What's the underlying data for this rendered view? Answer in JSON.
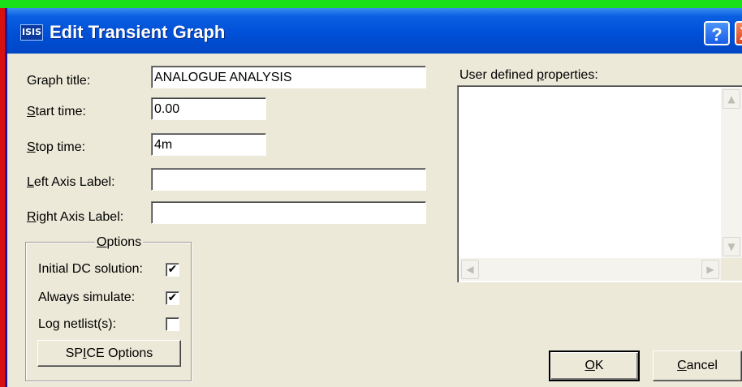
{
  "window": {
    "title": "Edit Transient Graph",
    "app_icon_text": "ISIS",
    "help_glyph": "?",
    "close_glyph": "X",
    "titlebar_color": "#0050d8"
  },
  "form": {
    "graph_title": {
      "label": "Graph title:",
      "value": "ANALOGUE ANALYSIS"
    },
    "start_time": {
      "label_ul": "S",
      "label_rest": "tart time:",
      "value": "0.00"
    },
    "stop_time": {
      "label_ul": "S",
      "label_rest": "top time:",
      "value": "4m"
    },
    "left_axis": {
      "label_ul": "L",
      "label_rest": "eft Axis Label:",
      "value": ""
    },
    "right_axis": {
      "label_ul": "R",
      "label_rest": "ight Axis Label:",
      "value": ""
    }
  },
  "options": {
    "legend_ul": "O",
    "legend_rest": "ptions",
    "initial_dc": {
      "label": "Initial DC solution:",
      "checked": true,
      "mark": "✔"
    },
    "always_simulate": {
      "label": "Always simulate:",
      "checked": true,
      "mark": "✔"
    },
    "log_netlist": {
      "label": "Log netlist(s):",
      "checked": false,
      "mark": ""
    },
    "spice_button": {
      "pre": "SP",
      "ul": "I",
      "post": "CE Options"
    }
  },
  "user_props": {
    "label_pre": "User defined ",
    "label_ul": "p",
    "label_post": "roperties:",
    "content": ""
  },
  "buttons": {
    "ok": {
      "ul": "O",
      "rest": "K"
    },
    "cancel": {
      "ul": "C",
      "rest": "ancel"
    }
  },
  "icons": {
    "scroll_up": "chevron-up-icon",
    "scroll_down": "chevron-down-icon",
    "scroll_left": "chevron-left-icon",
    "scroll_right": "chevron-right-icon"
  }
}
